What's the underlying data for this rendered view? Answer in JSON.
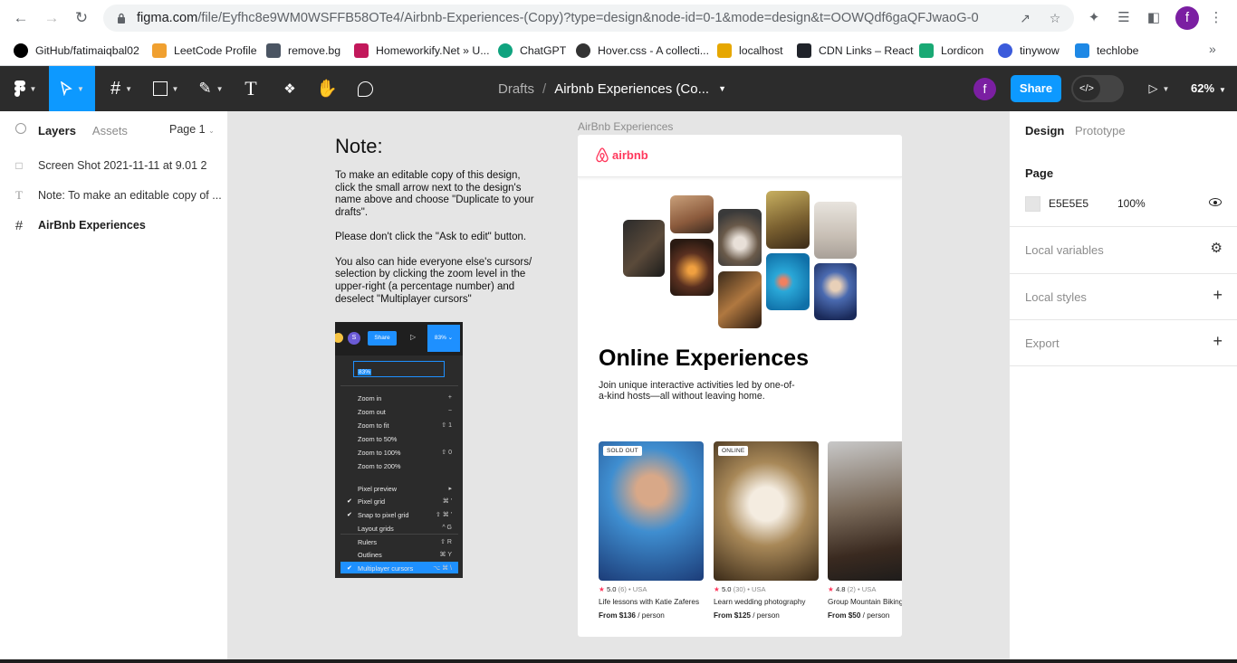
{
  "browser": {
    "url_main": "figma.com",
    "url_path": "/file/Eyfhc8e9WM0WSFFB58OTe4/Airbnb-Experiences-(Copy)?type=design&node-id=0-1&mode=design&t=OOWQdf6gaQFJwaoG-0",
    "profile_initial": "f"
  },
  "bookmarks": [
    {
      "label": "GitHub/fatimaiqbal02",
      "color": "#000000"
    },
    {
      "label": "LeetCode Profile",
      "color": "#f0a030"
    },
    {
      "label": "remove.bg",
      "color": "#4b5563"
    },
    {
      "label": "Homeworkify.Net » U...",
      "color": "#c2185b"
    },
    {
      "label": "ChatGPT",
      "color": "#10a37f"
    },
    {
      "label": "Hover.css - A collecti...",
      "color": "#333333"
    },
    {
      "label": "localhost",
      "color": "#e6a700"
    },
    {
      "label": "CDN Links – React",
      "color": "#20232a"
    },
    {
      "label": "Lordicon",
      "color": "#19a974"
    },
    {
      "label": "tinywow",
      "color": "#3b5bdb"
    },
    {
      "label": "techlobe",
      "color": "#1e88e5"
    }
  ],
  "toolbar": {
    "breadcrumb_parent": "Drafts",
    "breadcrumb_sep": "/",
    "file_name": "Airbnb Experiences (Co...",
    "user_initial": "f",
    "share_label": "Share",
    "zoom": "62%"
  },
  "left_panel": {
    "tab_layers": "Layers",
    "tab_assets": "Assets",
    "page_label": "Page 1",
    "layers": [
      {
        "name": "Screen Shot 2021-11-11 at 9.01 2",
        "icon": "image-icon"
      },
      {
        "name": "Note: To make an editable copy of ...",
        "icon": "text-icon"
      },
      {
        "name": "AirBnb Experiences",
        "icon": "frame-icon"
      }
    ]
  },
  "note": {
    "title": "Note:",
    "p1": "To make an editable copy of this design, click the small arrow next to the design's name above and choose \"Duplicate to your drafts\".",
    "p2": "Please don't click the \"Ask to edit\" button.",
    "p3": "You also can hide everyone else's cursors/ selection by clicking the zoom level in the upper-right (a percentage number) and deselect \"Multiplayer cursors\""
  },
  "menu_screenshot": {
    "share": "Share",
    "zoom": "83%",
    "items": [
      {
        "label": "Zoom in",
        "key": "+"
      },
      {
        "label": "Zoom out",
        "key": "−"
      },
      {
        "label": "Zoom to fit",
        "key": "⇧ 1"
      },
      {
        "label": "Zoom to 50%",
        "key": ""
      },
      {
        "label": "Zoom to 100%",
        "key": "⇧ 0"
      },
      {
        "label": "Zoom to 200%",
        "key": ""
      },
      {
        "label": "Pixel preview",
        "key": "▸"
      },
      {
        "label": "Pixel grid",
        "key": "⌘ '"
      },
      {
        "label": "Snap to pixel grid",
        "key": "⇧ ⌘ '"
      },
      {
        "label": "Layout grids",
        "key": "^ G"
      },
      {
        "label": "Rulers",
        "key": "⇧ R"
      },
      {
        "label": "Outlines",
        "key": "⌘ Y"
      },
      {
        "label": "Multiplayer cursors",
        "key": "⌥ ⌘ \\"
      }
    ]
  },
  "frame": {
    "label": "AirBnb Experiences",
    "logo_text": "airbnb",
    "hero_title": "Online Experiences",
    "hero_sub": "Join unique interactive activities led by one-of-a-kind hosts—all without leaving home.",
    "cards": [
      {
        "badge": "SOLD OUT",
        "rating": "5.0",
        "meta": "(6) • USA",
        "title": "Life lessons with Katie Zaferes",
        "price": "From $136",
        "unit": " / person"
      },
      {
        "badge": "ONLINE",
        "rating": "5.0",
        "meta": "(30) • USA",
        "title": "Learn wedding photography",
        "price": "From $125",
        "unit": " / person"
      },
      {
        "badge": "",
        "rating": "4.8",
        "meta": "(2) • USA",
        "title": "Group Mountain Biking",
        "price": "From $50",
        "unit": " / person"
      }
    ]
  },
  "right_panel": {
    "tab_design": "Design",
    "tab_prototype": "Prototype",
    "page_heading": "Page",
    "page_color": "E5E5E5",
    "page_opacity": "100%",
    "local_variables": "Local variables",
    "local_styles": "Local styles",
    "export": "Export"
  },
  "help_label": "?"
}
